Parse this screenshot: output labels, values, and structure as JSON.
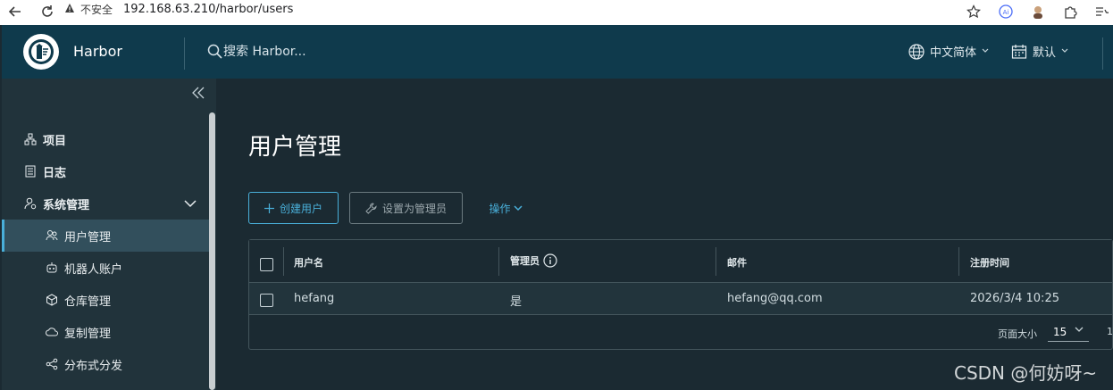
{
  "browser": {
    "security_label": "不安全",
    "url": "192.168.63.210/harbor/users"
  },
  "header": {
    "app_name": "Harbor",
    "search_placeholder": "搜索 Harbor...",
    "language": "中文简体",
    "date_format": "默认"
  },
  "sidebar": {
    "items": [
      {
        "label": "项目",
        "icon": "project-icon"
      },
      {
        "label": "日志",
        "icon": "log-icon"
      },
      {
        "label": "系统管理",
        "icon": "system-admin-icon"
      },
      {
        "label": "用户管理",
        "icon": "users-icon"
      },
      {
        "label": "机器人账户",
        "icon": "robot-icon"
      },
      {
        "label": "仓库管理",
        "icon": "registry-icon"
      },
      {
        "label": "复制管理",
        "icon": "replication-icon"
      },
      {
        "label": "分布式分发",
        "icon": "distribution-icon"
      }
    ]
  },
  "main": {
    "title": "用户管理",
    "buttons": {
      "create_user": "创建用户",
      "set_admin": "设置为管理员",
      "operations": "操作"
    },
    "table": {
      "columns": [
        "用户名",
        "管理员",
        "邮件",
        "注册时间"
      ],
      "rows": [
        {
          "username": "hefang",
          "admin": "是",
          "email": "hefang@qq.com",
          "registered": "2026/3/4 10:25"
        }
      ],
      "footer": {
        "page_size_label": "页面大小",
        "page_size": "15",
        "page_info": "1"
      }
    }
  },
  "watermark": "CSDN @何妨呀~",
  "colors": {
    "header_bg": "#0f3a4c",
    "sidebar_bg": "#21333b",
    "main_bg": "#1b2a32",
    "accent": "#49afd9"
  }
}
